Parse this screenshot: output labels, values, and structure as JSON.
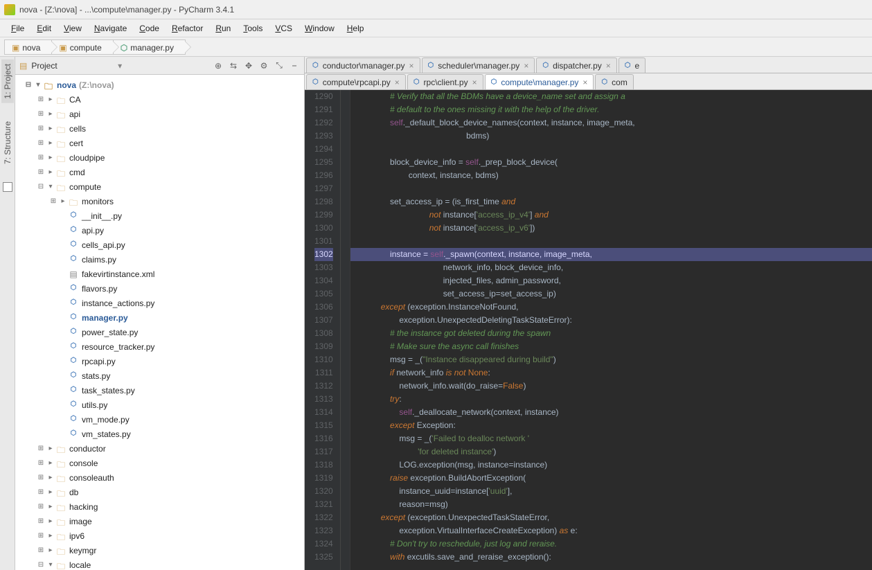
{
  "window": {
    "title": "nova - [Z:\\nova] - ...\\compute\\manager.py - PyCharm 3.4.1"
  },
  "menu": {
    "items": [
      "File",
      "Edit",
      "View",
      "Navigate",
      "Code",
      "Refactor",
      "Run",
      "Tools",
      "VCS",
      "Window",
      "Help"
    ]
  },
  "breadcrumb": {
    "items": [
      {
        "label": "nova",
        "icon": "pkg"
      },
      {
        "label": "compute",
        "icon": "pkg"
      },
      {
        "label": "manager.py",
        "icon": "py"
      }
    ]
  },
  "leftRail": {
    "items": [
      {
        "label": "1: Project",
        "active": true
      },
      {
        "label": "7: Structure",
        "active": false
      }
    ]
  },
  "projectHeader": {
    "title": "Project",
    "icons": [
      "⊕",
      "⇆",
      "✥",
      "⚙",
      "⤡",
      "⎯"
    ]
  },
  "tree": {
    "root": {
      "label": "nova",
      "hint": "(Z:\\nova)",
      "exp": true
    },
    "children": [
      {
        "label": "CA",
        "type": "dir",
        "exp": false,
        "depth": 1
      },
      {
        "label": "api",
        "type": "dir",
        "exp": false,
        "depth": 1
      },
      {
        "label": "cells",
        "type": "dir",
        "exp": false,
        "depth": 1
      },
      {
        "label": "cert",
        "type": "dir",
        "exp": false,
        "depth": 1
      },
      {
        "label": "cloudpipe",
        "type": "dir",
        "exp": false,
        "depth": 1
      },
      {
        "label": "cmd",
        "type": "dir",
        "exp": false,
        "depth": 1
      },
      {
        "label": "compute",
        "type": "dir",
        "exp": true,
        "depth": 1
      },
      {
        "label": "monitors",
        "type": "dir",
        "exp": false,
        "depth": 2
      },
      {
        "label": "__init__.py",
        "type": "py",
        "depth": 2
      },
      {
        "label": "api.py",
        "type": "py",
        "depth": 2
      },
      {
        "label": "cells_api.py",
        "type": "py",
        "depth": 2
      },
      {
        "label": "claims.py",
        "type": "py",
        "depth": 2
      },
      {
        "label": "fakevirtinstance.xml",
        "type": "xml",
        "depth": 2
      },
      {
        "label": "flavors.py",
        "type": "py",
        "depth": 2
      },
      {
        "label": "instance_actions.py",
        "type": "py",
        "depth": 2
      },
      {
        "label": "manager.py",
        "type": "py",
        "depth": 2,
        "sel": true
      },
      {
        "label": "power_state.py",
        "type": "py",
        "depth": 2
      },
      {
        "label": "resource_tracker.py",
        "type": "py",
        "depth": 2
      },
      {
        "label": "rpcapi.py",
        "type": "py",
        "depth": 2
      },
      {
        "label": "stats.py",
        "type": "py",
        "depth": 2
      },
      {
        "label": "task_states.py",
        "type": "py",
        "depth": 2
      },
      {
        "label": "utils.py",
        "type": "py",
        "depth": 2
      },
      {
        "label": "vm_mode.py",
        "type": "py",
        "depth": 2
      },
      {
        "label": "vm_states.py",
        "type": "py",
        "depth": 2
      },
      {
        "label": "conductor",
        "type": "dir",
        "exp": false,
        "depth": 1
      },
      {
        "label": "console",
        "type": "dir",
        "exp": false,
        "depth": 1
      },
      {
        "label": "consoleauth",
        "type": "dir",
        "exp": false,
        "depth": 1
      },
      {
        "label": "db",
        "type": "dir",
        "exp": false,
        "depth": 1
      },
      {
        "label": "hacking",
        "type": "dir",
        "exp": false,
        "depth": 1
      },
      {
        "label": "image",
        "type": "dir",
        "exp": false,
        "depth": 1
      },
      {
        "label": "ipv6",
        "type": "dir",
        "exp": false,
        "depth": 1
      },
      {
        "label": "keymgr",
        "type": "dir",
        "exp": false,
        "depth": 1
      },
      {
        "label": "locale",
        "type": "dir",
        "exp": true,
        "depth": 1
      }
    ]
  },
  "tabsTop": [
    {
      "label": "conductor\\manager.py",
      "close": true
    },
    {
      "label": "scheduler\\manager.py",
      "close": true
    },
    {
      "label": "dispatcher.py",
      "close": true
    },
    {
      "label": "e",
      "close": false,
      "truncated": true
    }
  ],
  "tabsBottom": [
    {
      "label": "compute\\rpcapi.py",
      "close": true
    },
    {
      "label": "rpc\\client.py",
      "close": true
    },
    {
      "label": "compute\\manager.py",
      "close": true,
      "active": true
    },
    {
      "label": "com",
      "close": false,
      "truncated": true
    }
  ],
  "code": {
    "startLine": 1290,
    "highlightLine": 1302,
    "lines": [
      {
        "t": "cmt",
        "txt": "                # Verify that all the BDMs have a device_name set and assign a"
      },
      {
        "t": "cmt",
        "txt": "                # default to the ones missing it with the help of the driver."
      },
      {
        "t": "code",
        "txt": "                self._default_block_device_names(context, instance, image_meta,"
      },
      {
        "t": "code",
        "txt": "                                                 bdms)"
      },
      {
        "t": "code",
        "txt": ""
      },
      {
        "t": "code",
        "txt": "                block_device_info = self._prep_block_device("
      },
      {
        "t": "code",
        "txt": "                        context, instance, bdms)"
      },
      {
        "t": "code",
        "txt": ""
      },
      {
        "t": "code",
        "txt": "                set_access_ip = (is_first_time <kw>and</kw>"
      },
      {
        "t": "code",
        "txt": "                                 <kw>not</kw> instance[<str>'access_ip_v4'</str>] <kw>and</kw>"
      },
      {
        "t": "code",
        "txt": "                                 <kw>not</kw> instance[<str>'access_ip_v6'</str>])"
      },
      {
        "t": "code",
        "txt": ""
      },
      {
        "t": "hl",
        "txt": "                instance = self._spawn(context, instance, image_meta,"
      },
      {
        "t": "code",
        "txt": "                                       network_info, block_device_info,"
      },
      {
        "t": "code",
        "txt": "                                       injected_files, admin_password,"
      },
      {
        "t": "code",
        "txt": "                                       set_access_ip=set_access_ip)"
      },
      {
        "t": "code",
        "txt": "            <kw>except</kw> (exception.InstanceNotFound,"
      },
      {
        "t": "code",
        "txt": "                    exception.UnexpectedDeletingTaskStateError):"
      },
      {
        "t": "cmt",
        "txt": "                # the instance got deleted during the spawn"
      },
      {
        "t": "cmt",
        "txt": "                # Make sure the async call finishes"
      },
      {
        "t": "code",
        "txt": "                msg = _(<str>\"Instance disappeared during build\"</str>)"
      },
      {
        "t": "code",
        "txt": "                <kw>if</kw> network_info <kw>is not</kw> <kw2>None</kw2>:"
      },
      {
        "t": "code",
        "txt": "                    network_info.wait(do_raise=<kw2>False</kw2>)"
      },
      {
        "t": "code",
        "txt": "                <kw>try</kw>:"
      },
      {
        "t": "code",
        "txt": "                    self._deallocate_network(context, instance)"
      },
      {
        "t": "code",
        "txt": "                <kw>except</kw> Exception:"
      },
      {
        "t": "code",
        "txt": "                    msg = _(<str>'Failed to dealloc network '</str>"
      },
      {
        "t": "code",
        "txt": "                            <str>'for deleted instance'</str>)"
      },
      {
        "t": "code",
        "txt": "                    LOG.exception(msg, instance=instance)"
      },
      {
        "t": "code",
        "txt": "                <kw>raise</kw> exception.BuildAbortException("
      },
      {
        "t": "code",
        "txt": "                    instance_uuid=instance[<str>'uuid'</str>],"
      },
      {
        "t": "code",
        "txt": "                    reason=msg)"
      },
      {
        "t": "code",
        "txt": "            <kw>except</kw> (exception.UnexpectedTaskStateError,"
      },
      {
        "t": "code",
        "txt": "                    exception.VirtualInterfaceCreateException) <kw>as</kw> e:"
      },
      {
        "t": "cmt",
        "txt": "                # Don't try to reschedule, just log and reraise."
      },
      {
        "t": "code",
        "txt": "                <kw>with</kw> excutils.save_and_reraise_exception():"
      }
    ]
  }
}
